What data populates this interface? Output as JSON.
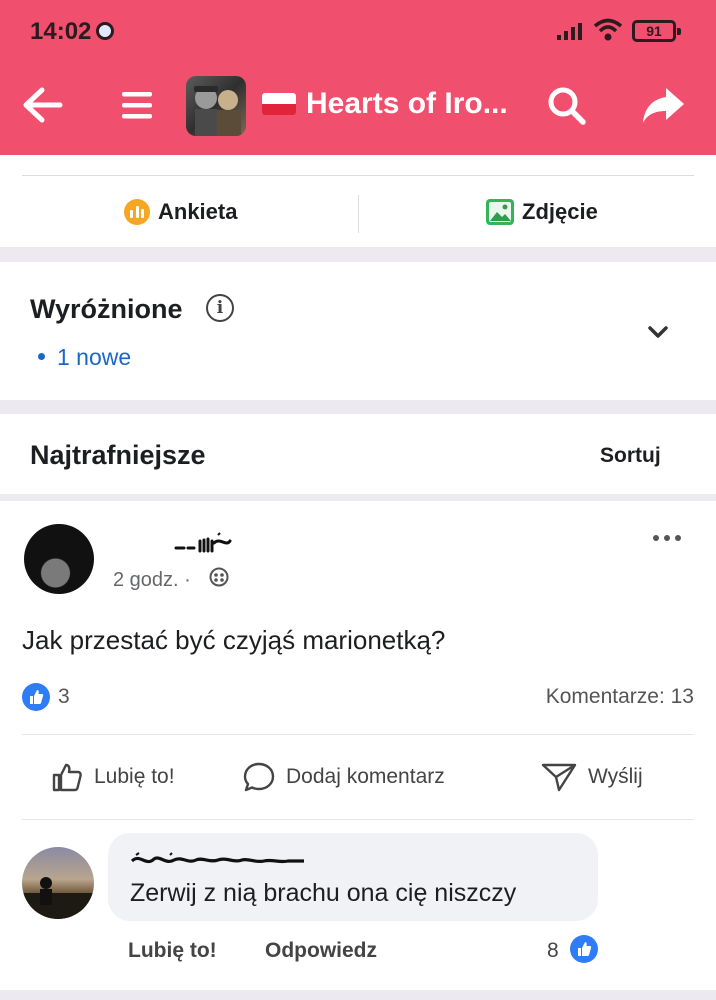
{
  "status_bar": {
    "time": "14:02",
    "battery": "91"
  },
  "nav": {
    "group_title": "Hearts of Iro..."
  },
  "composer": {
    "poll_label": "Ankieta",
    "photo_label": "Zdjęcie"
  },
  "featured": {
    "title": "Wyróżnione",
    "new_label": "1 nowe"
  },
  "relevant": {
    "title": "Najtrafniejsze",
    "sort_label": "Sortuj"
  },
  "post": {
    "meta": "2 godz. ·",
    "text": "Jak przestać być czyjąś marionetką?",
    "like_count": "3",
    "comments": "Komentarze: 13",
    "actions": {
      "like": "Lubię to!",
      "comment": "Dodaj komentarz",
      "send": "Wyślij"
    }
  },
  "comment": {
    "text": "Zerwij z nią brachu ona cię niszczy",
    "like_label": "Lubię to!",
    "reply_label": "Odpowiedz",
    "like_count": "8"
  },
  "colors": {
    "header": "#f0506e",
    "accent": "#1a67c9",
    "reaction": "#2e7cf6"
  }
}
